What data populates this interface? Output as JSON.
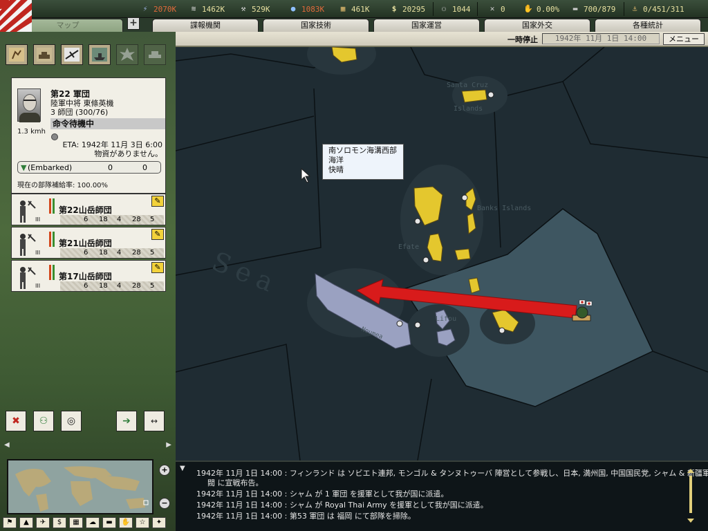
{
  "resources": [
    {
      "icon": "energy-icon",
      "glyph": "⚡",
      "value": "2070K",
      "color": "#e06a3a"
    },
    {
      "icon": "metal-icon",
      "glyph": "≋",
      "value": "1462K",
      "color": "#e8e1a0"
    },
    {
      "icon": "rare-material-icon",
      "glyph": "⚒",
      "value": "529K",
      "color": "#e8e1a0"
    },
    {
      "icon": "oil-icon",
      "glyph": "💧",
      "value": "1083K",
      "color": "#e06a3a"
    },
    {
      "icon": "supplies-icon",
      "glyph": "▦",
      "value": "461K",
      "color": "#e8e1a0"
    },
    {
      "icon": "money-icon",
      "glyph": "$",
      "value": "20295",
      "color": "#e8e1a0"
    }
  ],
  "stats": [
    {
      "icon": "manpower-icon",
      "glyph": "⚇",
      "value": "1044"
    },
    {
      "icon": "crossed-swords-icon",
      "glyph": "✕",
      "value": "0"
    },
    {
      "icon": "dissent-icon",
      "glyph": "✋",
      "value": "0.00%"
    },
    {
      "icon": "transport-icon",
      "glyph": "▬",
      "value": "700/879"
    },
    {
      "icon": "convoy-icon",
      "glyph": "⚓",
      "value": "0/451/311"
    }
  ],
  "tabs": [
    {
      "label": "マップ",
      "active": true
    },
    {
      "label": "諜報機関"
    },
    {
      "label": "国家技術"
    },
    {
      "label": "国家運営"
    },
    {
      "label": "国家外交"
    },
    {
      "label": "各種統計"
    }
  ],
  "status": {
    "pause": "一時停止",
    "date": "1942年 11月 1日 14:00",
    "menu": "メニュー"
  },
  "corps": {
    "name": "第22 軍団",
    "commander": "陸軍中将 東條英機",
    "composition": "3 師団 (300/76)",
    "speed": "1.3 kmh",
    "orders": "命令待機中",
    "eta": "ETA: 1942年 11月 3日 6:00",
    "supply_note": "物資がありません。",
    "embarked_label": "(Embarked)",
    "embarked_a": "0",
    "embarked_b": "0",
    "supply_rate": "現在の部隊補給率: 100.00%"
  },
  "divisions": [
    {
      "name": "第22山岳師団",
      "tier": "III",
      "stats": [
        "6",
        "18",
        "4",
        "28",
        "5"
      ]
    },
    {
      "name": "第21山岳師団",
      "tier": "III",
      "stats": [
        "6",
        "18",
        "4",
        "28",
        "5"
      ]
    },
    {
      "name": "第17山岳師団",
      "tier": "III",
      "stats": [
        "6",
        "18",
        "4",
        "28",
        "5"
      ]
    }
  ],
  "map": {
    "tooltip_region": "南ソロモン海溝西部",
    "tooltip_terrain": "海洋",
    "tooltip_weather": "快晴",
    "labels": [
      "Santa Cruz",
      "Islands",
      "Banks Islands",
      "Efate",
      "Lifou",
      "Noumea",
      "Sea"
    ]
  },
  "log": [
    "1942年 11月 1日 14:00 : フィンランド は ソビエト連邦, モンゴル & タンヌトゥーバ 陣営として参戦し、日本, 満州国, 中国国民党, シャム & 新疆軍",
    "閥 に宣戦布告。",
    "1942年 11月 1日 14:00 : シャム が 1 軍団 を援軍として我が国に派遣。",
    "1942年 11月 1日 14:00 : シャム が Royal Thai Army を援軍として我が国に派遣。",
    "1942年 11月 1日 14:00 : 第53 軍団 は 福岡 にて部隊を掃除。"
  ]
}
